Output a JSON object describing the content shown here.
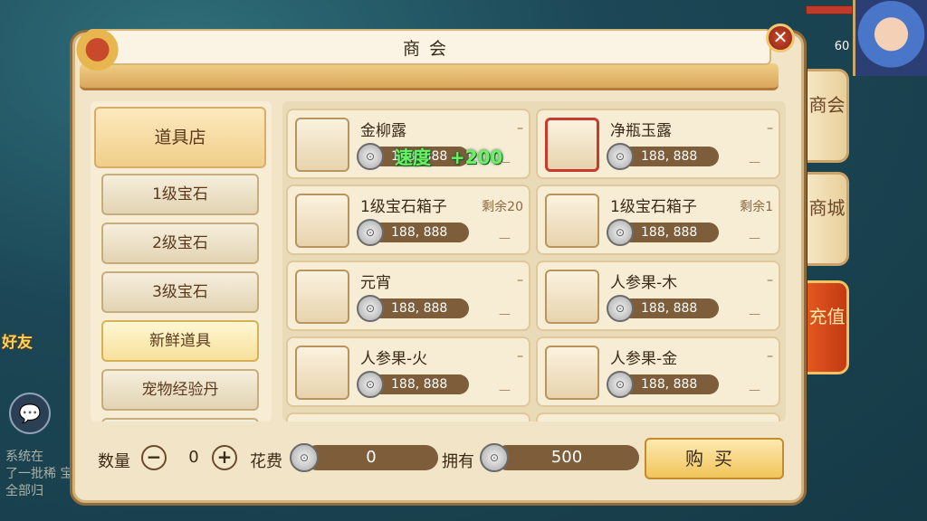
{
  "window": {
    "title": "商会",
    "close_icon": "close-icon"
  },
  "background": {
    "level": "60",
    "friend": "好友",
    "chat_text": "了一批稀 宝全部归",
    "chat_tag": "系统在"
  },
  "side_tabs": [
    "商会",
    "商城",
    "充值"
  ],
  "categories": {
    "main": "道具店",
    "items": [
      "1级宝石",
      "2级宝石",
      "3级宝石",
      "新鲜道具",
      "宠物经验丹"
    ],
    "selected": "新鲜道具"
  },
  "items": [
    {
      "name": "金柳露",
      "price": "188, 888",
      "extra": "–",
      "icon": "golden-willow-dew-icon",
      "float_left": "速度",
      "float_right": "+200"
    },
    {
      "name": "净瓶玉露",
      "price": "188, 888",
      "extra": "–",
      "icon": "jade-vase-dew-icon"
    },
    {
      "name": "1级宝石箱子",
      "price": "188, 888",
      "extra": "剩余20",
      "icon": "gem-chest-icon"
    },
    {
      "name": "1级宝石箱子",
      "price": "188, 888",
      "extra": "剩余1",
      "icon": "gem-chest-icon"
    },
    {
      "name": "元宵",
      "price": "188, 888",
      "extra": "–",
      "icon": "glutinous-ball-icon"
    },
    {
      "name": "人参果-木",
      "price": "188, 888",
      "extra": "–",
      "icon": "ginseng-fruit-wood-icon"
    },
    {
      "name": "人参果-火",
      "price": "188, 888",
      "extra": "–",
      "icon": "ginseng-fruit-fire-icon"
    },
    {
      "name": "人参果-金",
      "price": "188, 888",
      "extra": "–",
      "icon": "ginseng-fruit-gold-icon"
    }
  ],
  "bottom": {
    "qty_label": "数量",
    "qty_value": "0",
    "minus": "−",
    "plus": "+",
    "cost_label": "花费",
    "cost_value": "0",
    "own_label": "拥有",
    "own_value": "500",
    "buy_label": "购买",
    "coin_icon": "silver-coin-icon"
  },
  "colors": {
    "accent": "#f1c45a",
    "price_bar": "#7d5d3a",
    "panel": "#f2e4c6",
    "recharge": "#c23a14"
  }
}
